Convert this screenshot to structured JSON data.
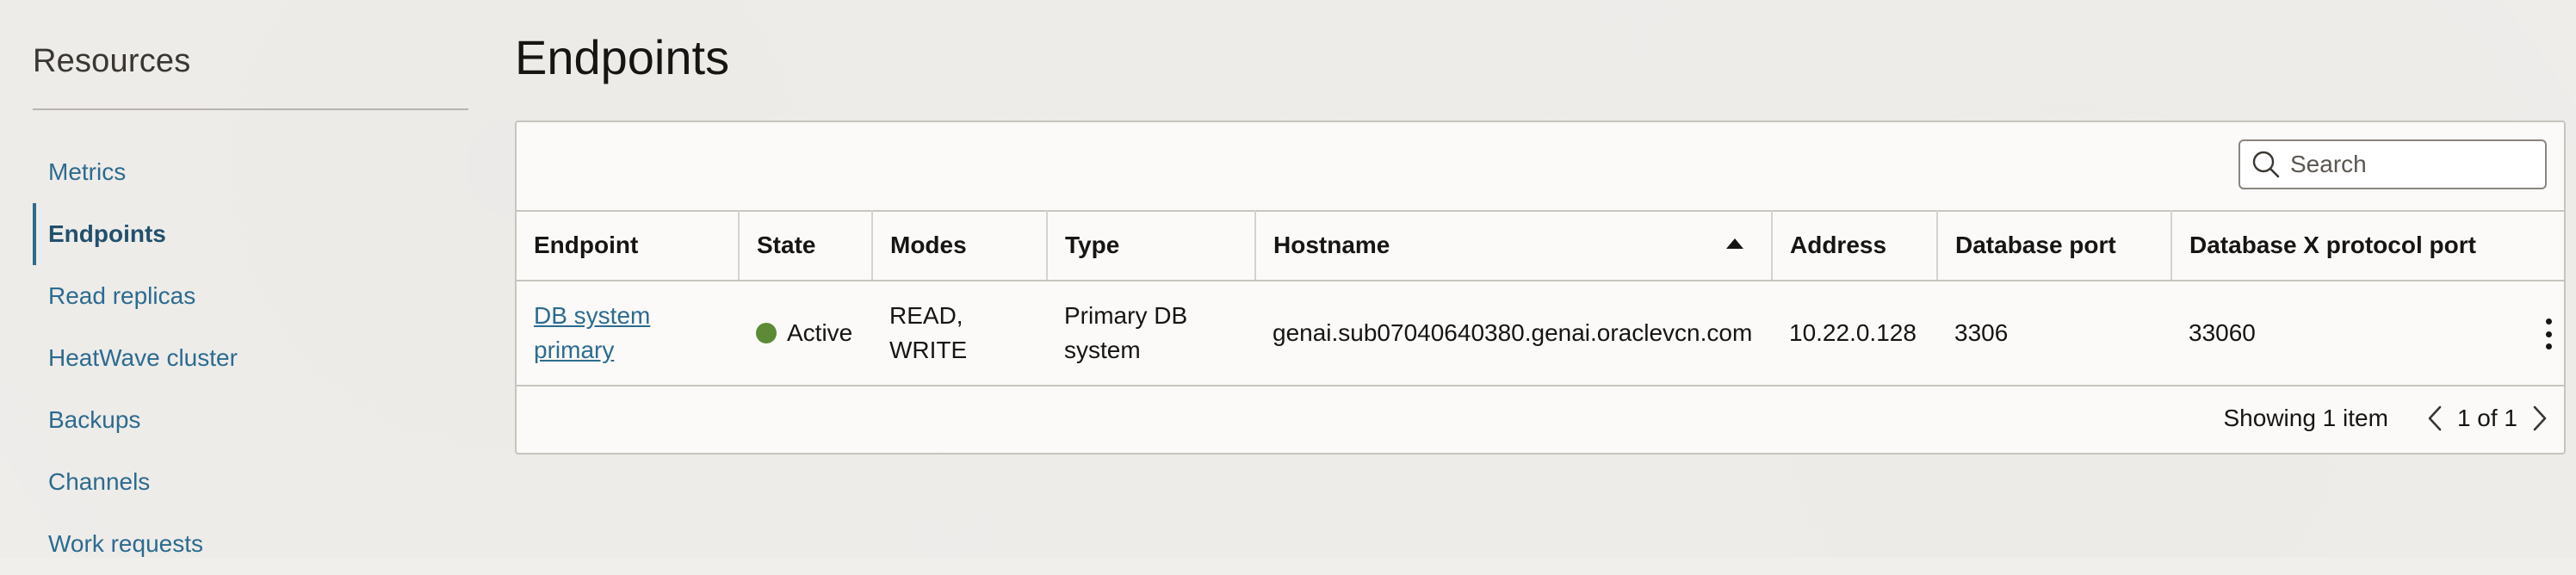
{
  "sidebar": {
    "title": "Resources",
    "items": [
      {
        "label": "Metrics"
      },
      {
        "label": "Endpoints"
      },
      {
        "label": "Read replicas"
      },
      {
        "label": "HeatWave cluster"
      },
      {
        "label": "Backups"
      },
      {
        "label": "Channels"
      },
      {
        "label": "Work requests"
      }
    ],
    "active_index": 1
  },
  "main": {
    "title": "Endpoints",
    "search": {
      "placeholder": "Search",
      "value": ""
    },
    "table": {
      "columns": [
        "Endpoint",
        "State",
        "Modes",
        "Type",
        "Hostname",
        "Address",
        "Database port",
        "Database X protocol port"
      ],
      "sorted_column": "Hostname",
      "sort_direction": "ascending",
      "rows": [
        {
          "endpoint": "DB system primary",
          "state": "Active",
          "state_color": "#5c8a36",
          "modes": "READ, WRITE",
          "type": "Primary DB system",
          "hostname": "genai.sub07040640380.genai.oraclevcn.com",
          "address": "10.22.0.128",
          "database_port": "3306",
          "x_protocol_port": "33060"
        }
      ]
    },
    "footer": {
      "showing": "Showing 1 item",
      "page_info": "1 of 1"
    }
  },
  "colors": {
    "link": "#2c6b8f",
    "active_nav": "#22506d",
    "background": "#f1efec",
    "card": "#fbfaf8"
  }
}
